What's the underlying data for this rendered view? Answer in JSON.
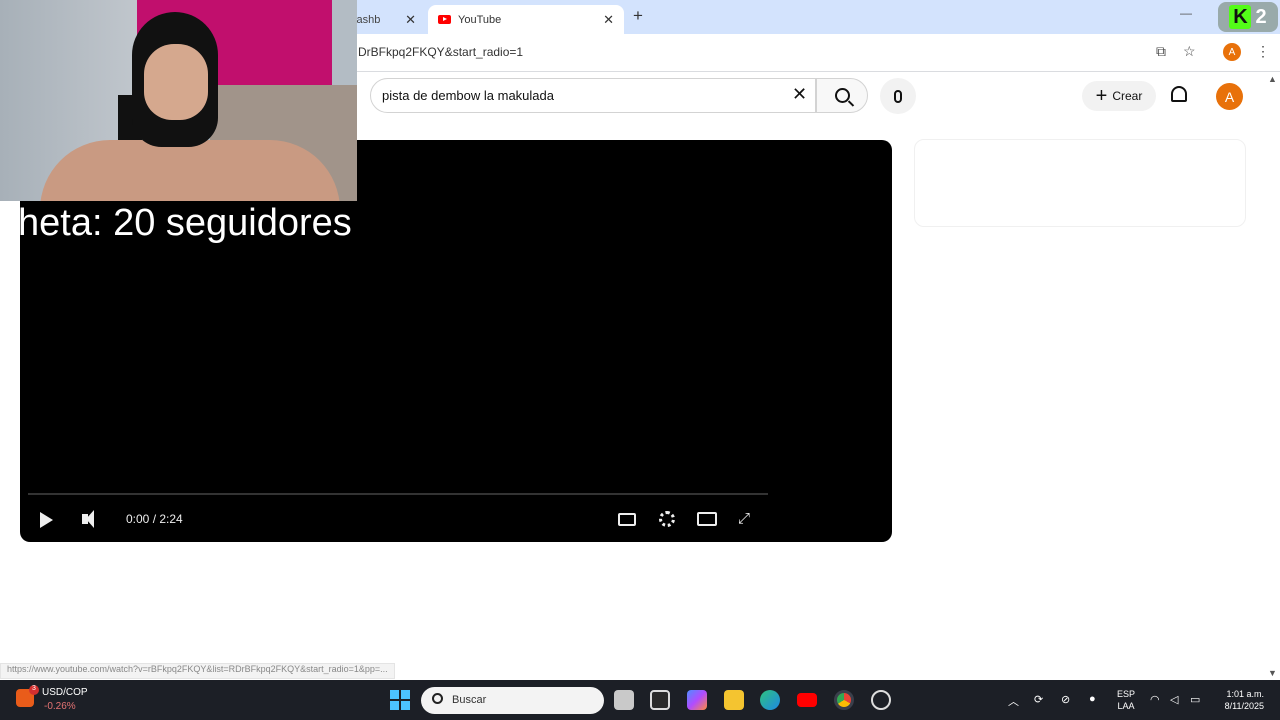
{
  "browser": {
    "tabs": [
      {
        "title": "k Dashb",
        "close": "✕"
      },
      {
        "title": "YouTube",
        "close": "✕"
      }
    ],
    "new_tab": "+",
    "minimize": "—",
    "url": "DrBFkpq2FKQY&start_radio=1",
    "status_url": "https://www.youtube.com/watch?v=rBFkpq2FKQY&list=RDrBFkpq2FKQY&start_radio=1&pp=..."
  },
  "overlay": {
    "meta_text": "heta: 20 seguidores",
    "kick_badge": {
      "letter": "K",
      "count": "2"
    }
  },
  "youtube": {
    "search_query": "pista de dembow la makulada",
    "clear": "✕",
    "create_label": "Crear",
    "create_plus": "+",
    "avatar_letter": "A"
  },
  "player": {
    "time": "0:00 / 2:24"
  },
  "taskbar": {
    "widget_title": "USD/COP",
    "widget_change": "-0.26%",
    "widget_badge": "3",
    "search_placeholder": "Buscar",
    "lang_top": "ESP",
    "lang_bottom": "LAA",
    "time": "1:01 a.m.",
    "date": "8/11/2025"
  }
}
